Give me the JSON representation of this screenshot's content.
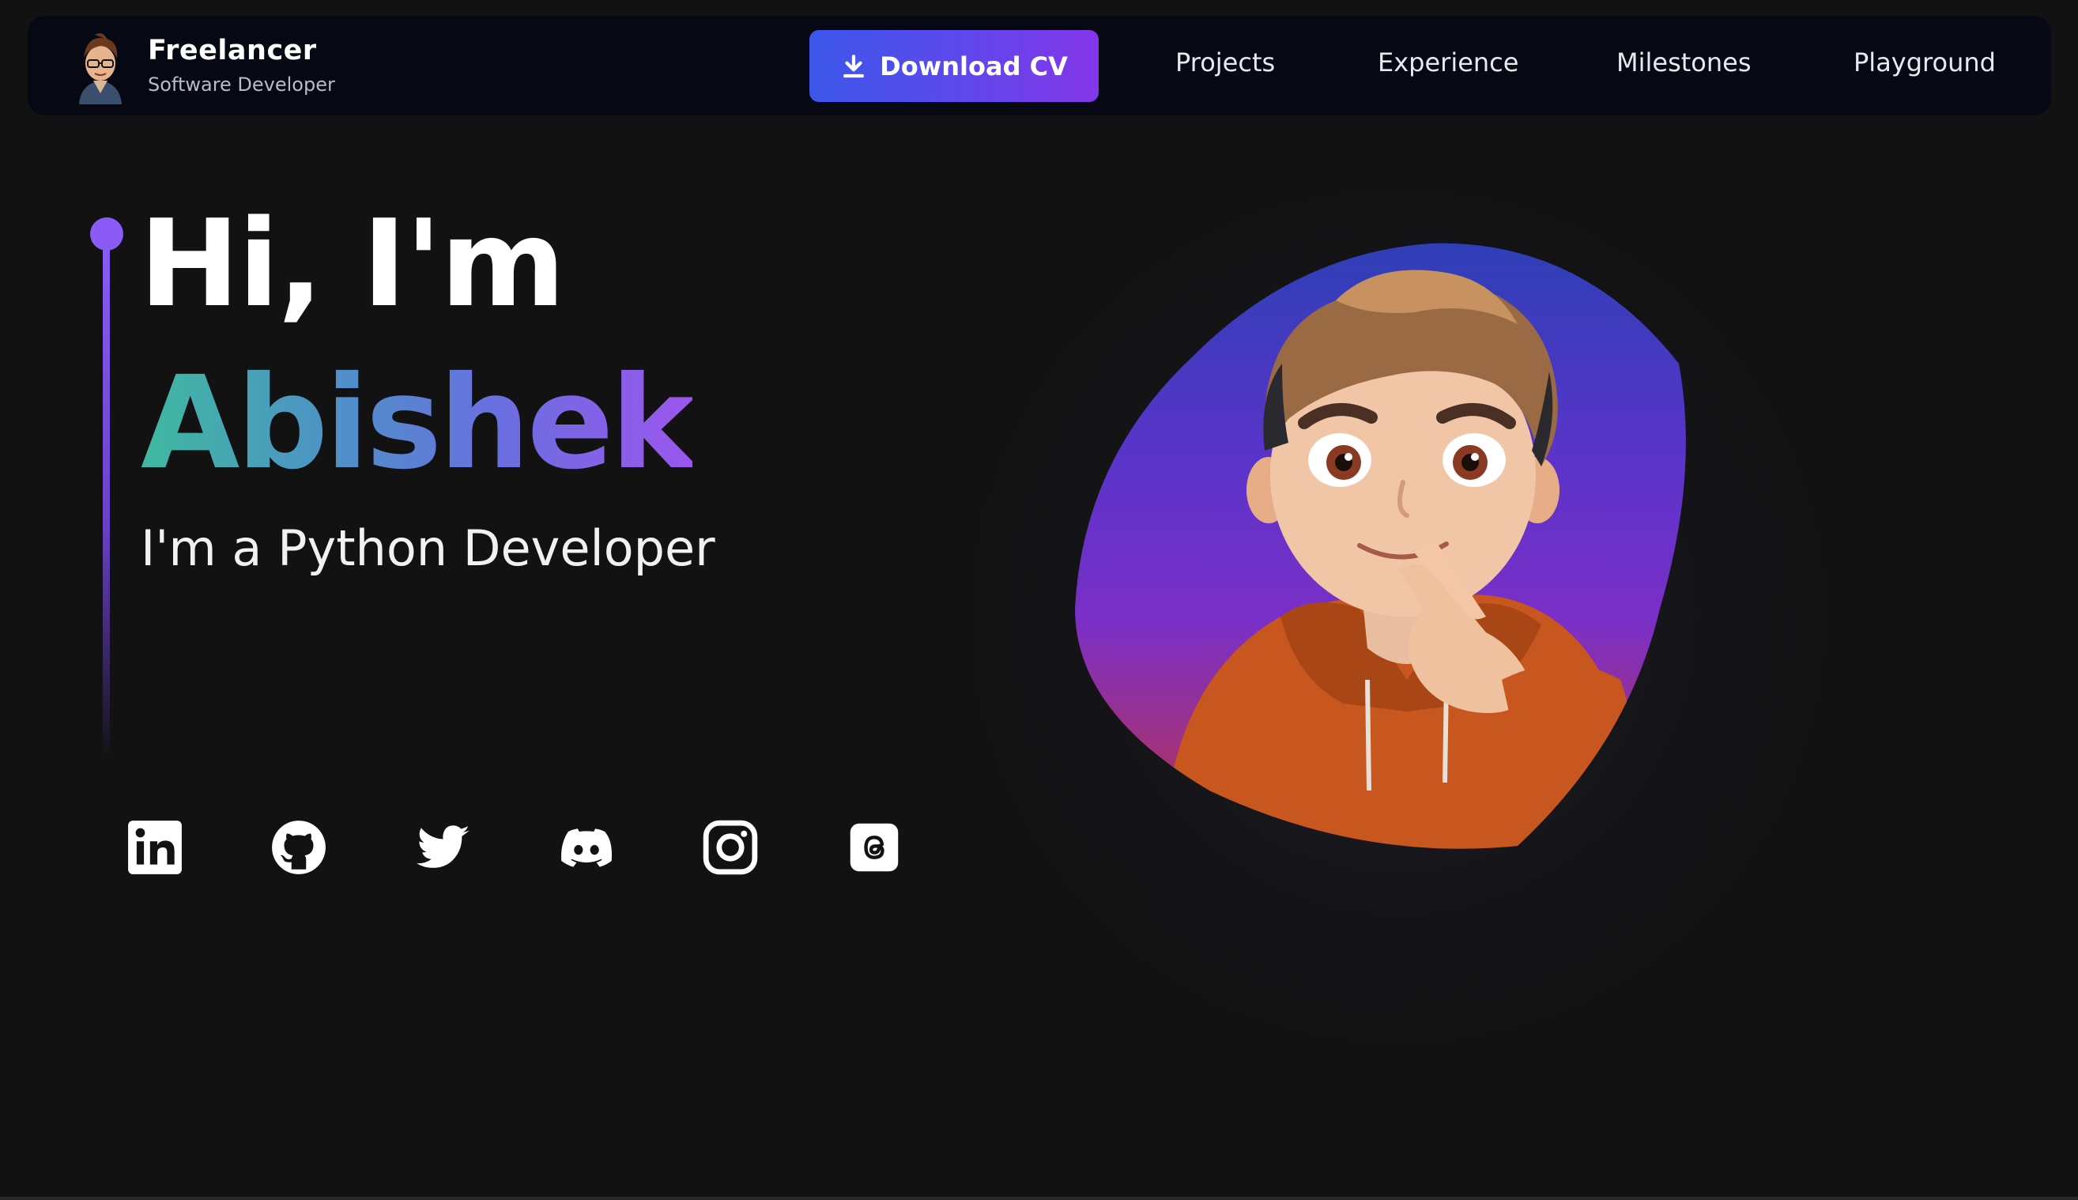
{
  "brand": {
    "title": "Freelancer",
    "subtitle": "Software Developer",
    "avatar_icon": "avatar-icon"
  },
  "nav": {
    "download_label": "Download CV",
    "download_icon": "download-icon",
    "links": [
      "Projects",
      "Experience",
      "Milestones",
      "Playground"
    ]
  },
  "hero": {
    "greeting": "Hi, I'm",
    "name": "Abishek",
    "role": "I'm a Python Developer"
  },
  "social": {
    "icons": [
      "linkedin-icon",
      "github-icon",
      "twitter-icon",
      "discord-icon",
      "instagram-icon",
      "threads-icon"
    ]
  },
  "colors": {
    "accent_purple": "#8a5cf5",
    "name_gradient_start": "#3fb9a0",
    "name_gradient_end": "#9b56ee",
    "button_gradient_start": "#3c57ea",
    "button_gradient_end": "#8436e8",
    "background": "#121212",
    "navbar": "#060814"
  }
}
